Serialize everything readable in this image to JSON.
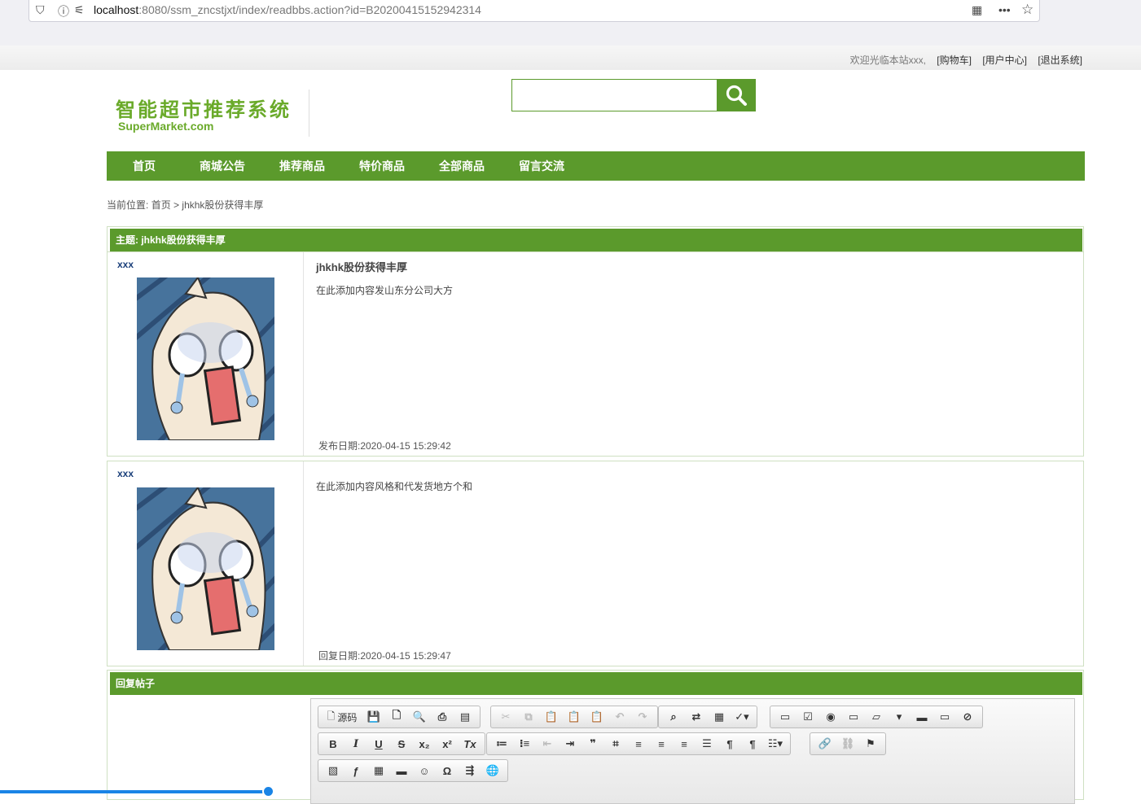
{
  "browser": {
    "url_host": "localhost",
    "url_rest": ":8080/ssm_zncstjxt/index/readbbs.action?id=B20200415152942314"
  },
  "top_links": {
    "welcome": "欢迎光临本站xxx,",
    "cart": "[购物车]",
    "user_center": "[用户中心]",
    "logout": "[退出系统]"
  },
  "logo": {
    "cn": "智能超市推荐系统",
    "en": "SuperMarket.com"
  },
  "search": {
    "value": "",
    "placeholder": ""
  },
  "nav": [
    "首页",
    "商城公告",
    "推荐商品",
    "特价商品",
    "全部商品",
    "留言交流"
  ],
  "breadcrumb": {
    "prefix": "当前位置:",
    "home": "首页",
    "sep": ">",
    "current": "jhkhk股份获得丰厚"
  },
  "thread": {
    "subject_label": "主题: jhkhk股份获得丰厚",
    "posts": [
      {
        "author": "xxx",
        "title": "jhkhk股份获得丰厚",
        "content": "在此添加内容发山东分公司大方",
        "date": "发布日期:2020-04-15 15:29:42"
      },
      {
        "author": "xxx",
        "title": "",
        "content": "在此添加内容风格和代发货地方个和",
        "date": "回复日期:2020-04-15 15:29:47"
      }
    ]
  },
  "reply": {
    "head": "回复帖子",
    "source_button": "源码"
  },
  "colors": {
    "brand_green": "#5b9a2c",
    "logo_green": "#6aaa2a"
  }
}
